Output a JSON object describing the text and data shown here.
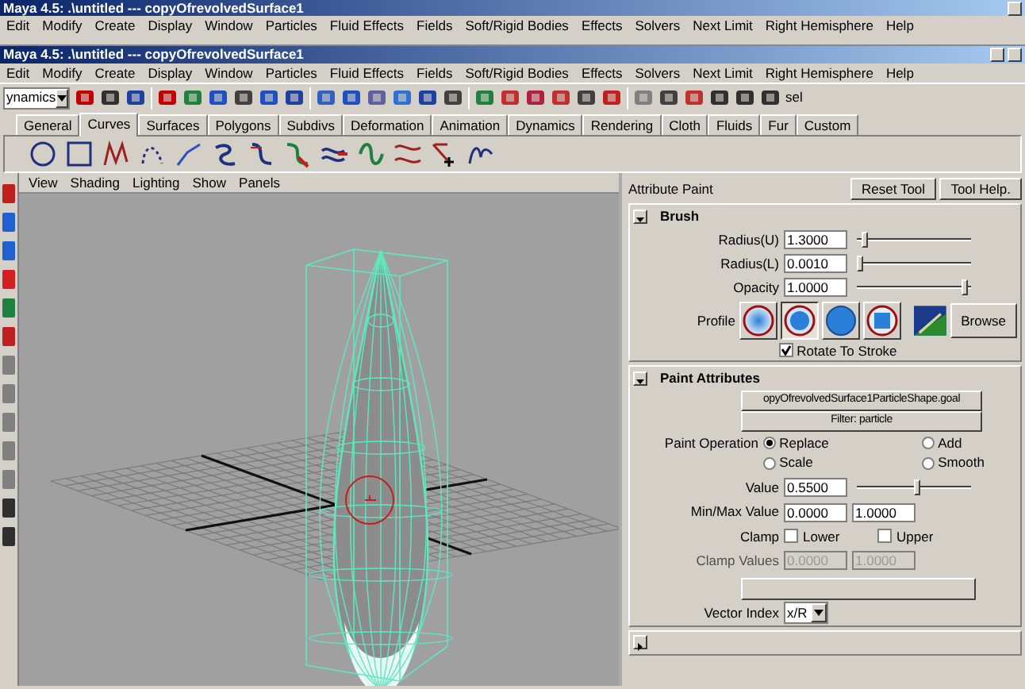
{
  "back_window": {
    "title": "Maya 4.5: .\\untitled  ---  copyOfrevolvedSurface1",
    "menu": [
      "Edit",
      "Modify",
      "Create",
      "Display",
      "Window",
      "Particles",
      "Fluid Effects",
      "Fields",
      "Soft/Rigid Bodies",
      "Effects",
      "Solvers",
      "Next Limit",
      "Right Hemisphere",
      "Help"
    ]
  },
  "window": {
    "title": "Maya 4.5: .\\untitled  ---  copyOfrevolvedSurface1",
    "menu": [
      "Edit",
      "Modify",
      "Create",
      "Display",
      "Window",
      "Particles",
      "Fluid Effects",
      "Fields",
      "Soft/Rigid Bodies",
      "Effects",
      "Solvers",
      "Next Limit",
      "Right Hemisphere",
      "Help"
    ]
  },
  "status_line": {
    "mode": "ynamics",
    "selection_label": "sel"
  },
  "shelf_tabs": [
    {
      "label": "General",
      "selected": false
    },
    {
      "label": "Curves",
      "selected": true
    },
    {
      "label": "Surfaces",
      "selected": false
    },
    {
      "label": "Polygons",
      "selected": false
    },
    {
      "label": "Subdivs",
      "selected": false
    },
    {
      "label": "Deformation",
      "selected": false
    },
    {
      "label": "Animation",
      "selected": false
    },
    {
      "label": "Dynamics",
      "selected": false
    },
    {
      "label": "Rendering",
      "selected": false
    },
    {
      "label": "Cloth",
      "selected": false
    },
    {
      "label": "Fluids",
      "selected": false
    },
    {
      "label": "Fur",
      "selected": false
    },
    {
      "label": "Custom",
      "selected": false
    }
  ],
  "viewport": {
    "menu": [
      "View",
      "Shading",
      "Lighting",
      "Show",
      "Panels"
    ]
  },
  "tool_settings": {
    "title": "Attribute Paint",
    "buttons": [
      "Reset Tool",
      "Tool Help."
    ],
    "brush": {
      "title": "Brush",
      "expanded": true,
      "fields": [
        {
          "label": "Radius(U)",
          "value": "1.3000",
          "level": 0.05
        },
        {
          "label": "Radius(L)",
          "value": "0.0010",
          "level": 0.0
        },
        {
          "label": "Opacity",
          "value": "1.0000",
          "level": 1.0
        }
      ],
      "profile_label": "Profile",
      "profiles": [
        {
          "kind": "gaussian",
          "selected": false
        },
        {
          "kind": "soft",
          "selected": true
        },
        {
          "kind": "solid",
          "selected": false
        },
        {
          "kind": "square",
          "selected": false
        }
      ],
      "browse": "Browse",
      "rotate_to_stroke": {
        "label": "Rotate To Stroke",
        "checked": true
      }
    },
    "paint_attributes": {
      "title": "Paint Attributes",
      "expanded": true,
      "attribute": "opyOfrevolvedSurface1ParticleShape.goal",
      "filter": "Filter: particle",
      "operation_label": "Paint Operation",
      "operations": [
        {
          "label": "Replace",
          "selected": true
        },
        {
          "label": "Add",
          "selected": false
        },
        {
          "label": "Scale",
          "selected": false
        },
        {
          "label": "Smooth",
          "selected": false
        }
      ],
      "value": {
        "label": "Value",
        "value": "0.5500",
        "level": 0.55
      },
      "min_max": {
        "label": "Min/Max Value",
        "min": "0.0000",
        "max": "1.0000"
      },
      "clamp": {
        "label": "Clamp",
        "options": [
          {
            "label": "Lower",
            "checked": false
          },
          {
            "label": "Upper",
            "checked": false
          }
        ]
      },
      "clamp_values": {
        "label": "Clamp Values",
        "min": "0.0000",
        "max": "1.0000",
        "disabled": true
      },
      "vector_index": {
        "label": "Vector Index",
        "value": "x/R"
      }
    },
    "next_section": {
      "expanded": false
    }
  }
}
